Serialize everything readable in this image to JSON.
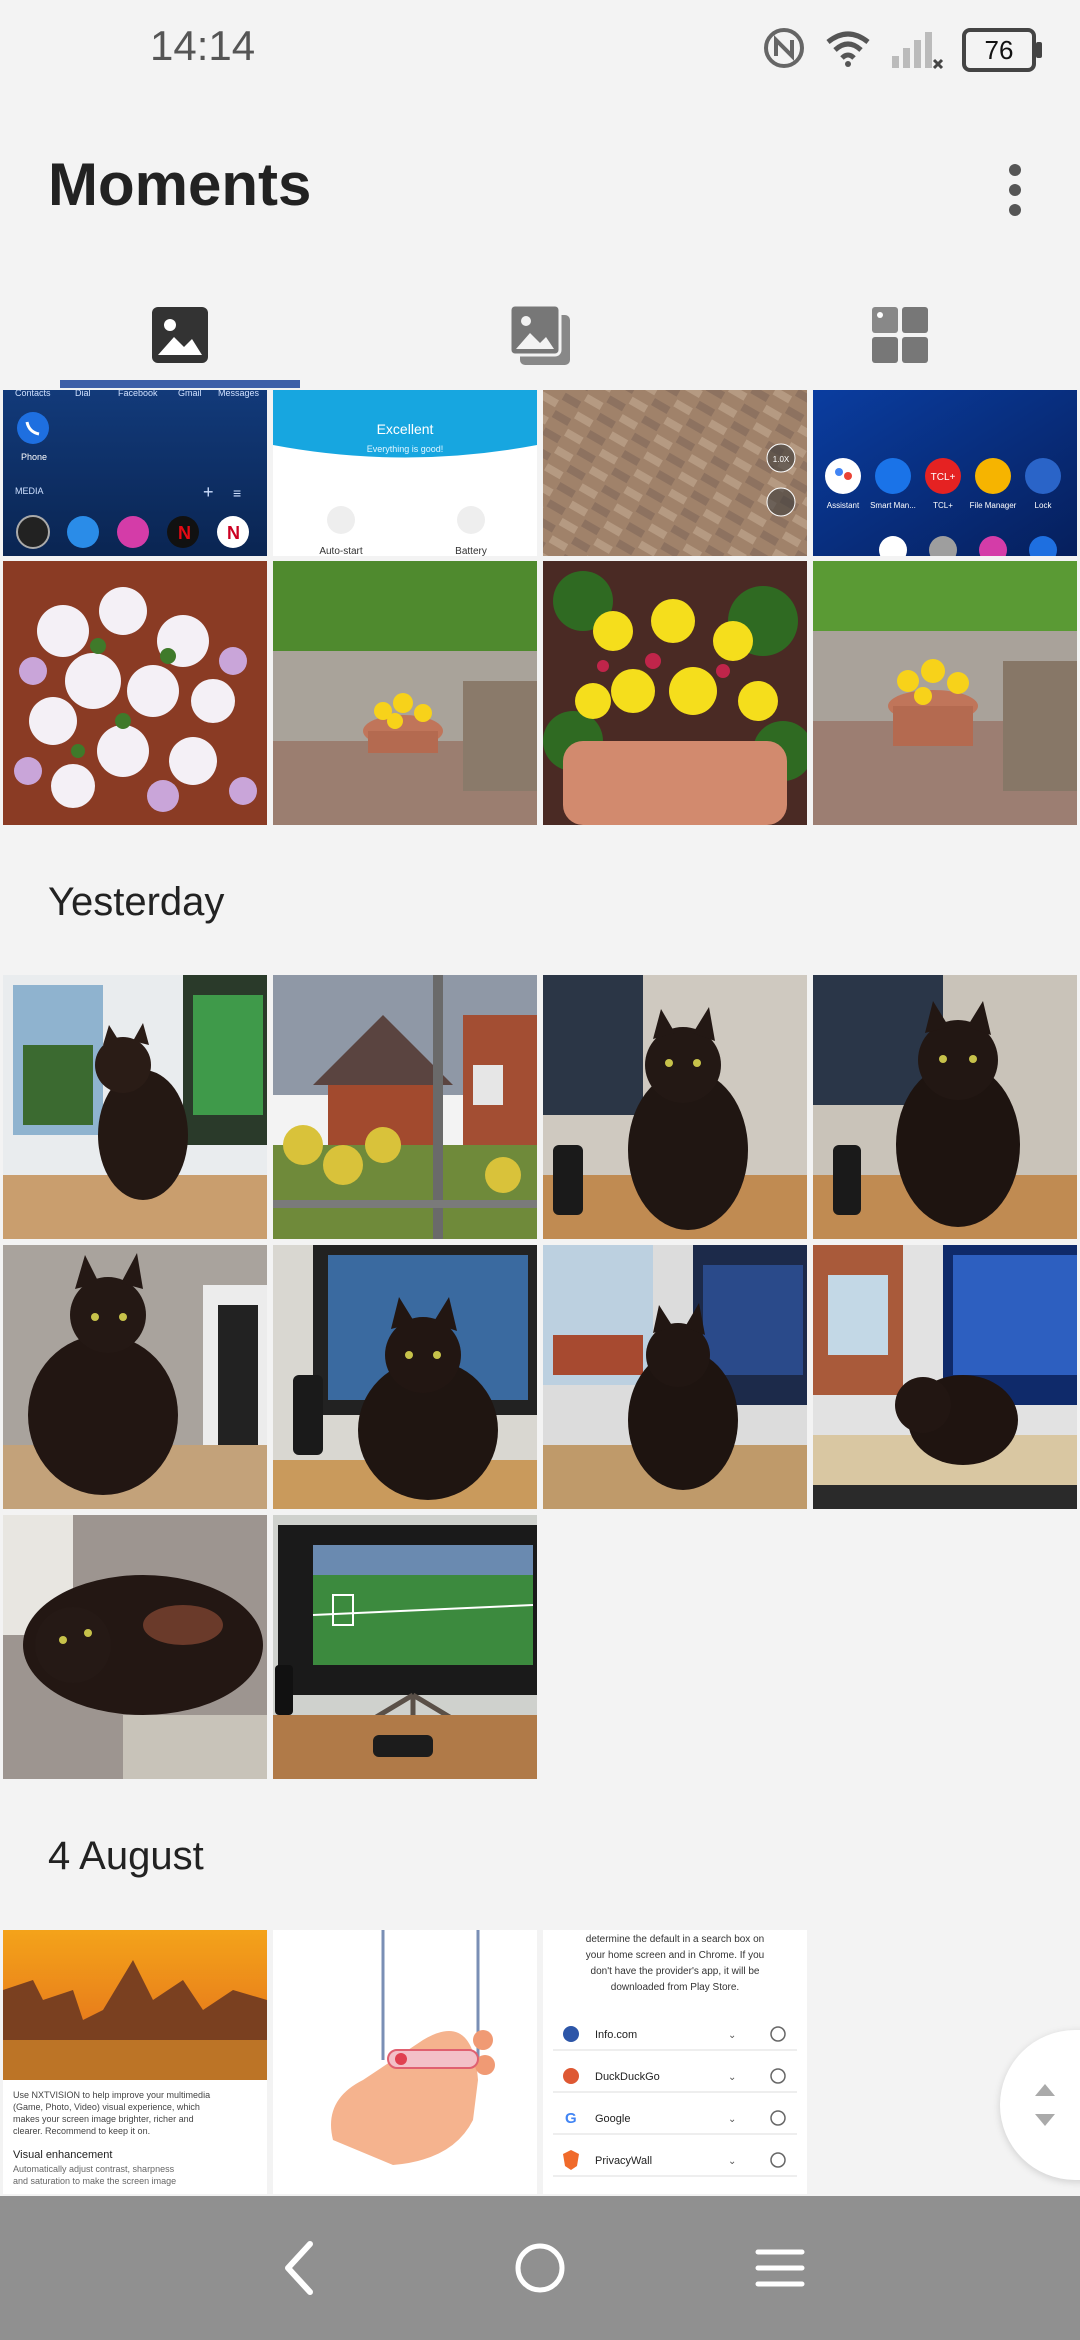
{
  "status": {
    "time": "14:14",
    "battery": "76"
  },
  "app": {
    "title": "Moments"
  },
  "tabs": [
    {
      "name": "photos",
      "icon": "image-icon"
    },
    {
      "name": "albums",
      "icon": "albums-icon"
    },
    {
      "name": "collections",
      "icon": "grid-icon"
    }
  ],
  "sections": {
    "yesterday": "Yesterday",
    "august": "4 August"
  },
  "thumb_text": {
    "home_top": [
      "Contacts",
      "Dial",
      "Facebook",
      "Gmail",
      "Messages"
    ],
    "phone": "Phone",
    "media": "MEDIA",
    "excellent_title": "Excellent",
    "excellent_sub": "Everything is good!",
    "autostart": "Auto-start",
    "battery": "Battery",
    "apps": [
      "Assistant",
      "Smart Man...",
      "TCL+",
      "File Manager",
      "Lock"
    ],
    "tcl_badge": "TCL+",
    "zoom": "1.0X",
    "nxt_text": [
      "Use NXTVISION to help improve your multimedia",
      "(Game, Photo, Video) visual experience, which",
      "makes your screen image brighter, richer and",
      "clearer. Recommend to keep it on."
    ],
    "visual_title": "Visual enhancement",
    "visual_sub": [
      "Automatically adjust contrast, sharpness",
      "and saturation to make the screen image"
    ],
    "search_text": [
      "determine the default in a search box on",
      "your home screen and in Chrome. If you",
      "don't have the provider's app, it will be",
      "downloaded from Play Store."
    ],
    "engines": [
      "Info.com",
      "DuckDuckGo",
      "Google",
      "PrivacyWall"
    ]
  },
  "colors": {
    "accent": "#3e5fa8",
    "nav": "#909090"
  }
}
